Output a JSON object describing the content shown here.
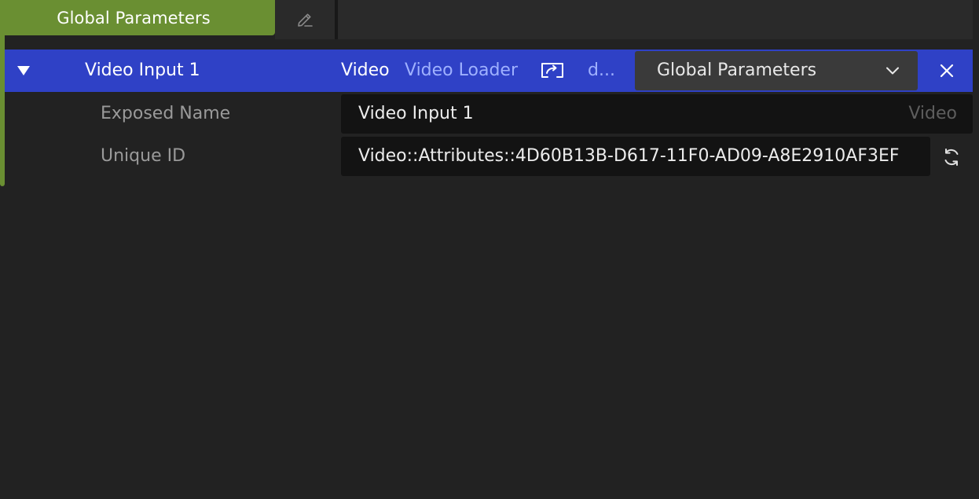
{
  "header": {
    "tab_label": "Global Parameters"
  },
  "parameter": {
    "name": "Video Input 1",
    "type": "Video",
    "source": "Video Loader",
    "more": "d...",
    "scope": "Global Parameters",
    "attributes": [
      {
        "label": "Exposed Name",
        "value": "Video Input 1",
        "hint": "Video"
      },
      {
        "label": "Unique ID",
        "value": "Video::Attributes::4D60B13B-D617-11F0-AD09-A8E2910AF3EF"
      }
    ]
  },
  "colors": {
    "group_accent": "#6a8f32",
    "selected_row": "#2f41c6",
    "background": "#222222",
    "field_background": "#131313"
  },
  "icons": {
    "edit": "pencil-icon",
    "collapse": "triangle-down-icon",
    "cast": "cast-screen-icon",
    "dropdown": "chevron-down-icon",
    "remove": "close-icon",
    "regenerate": "refresh-icon"
  }
}
